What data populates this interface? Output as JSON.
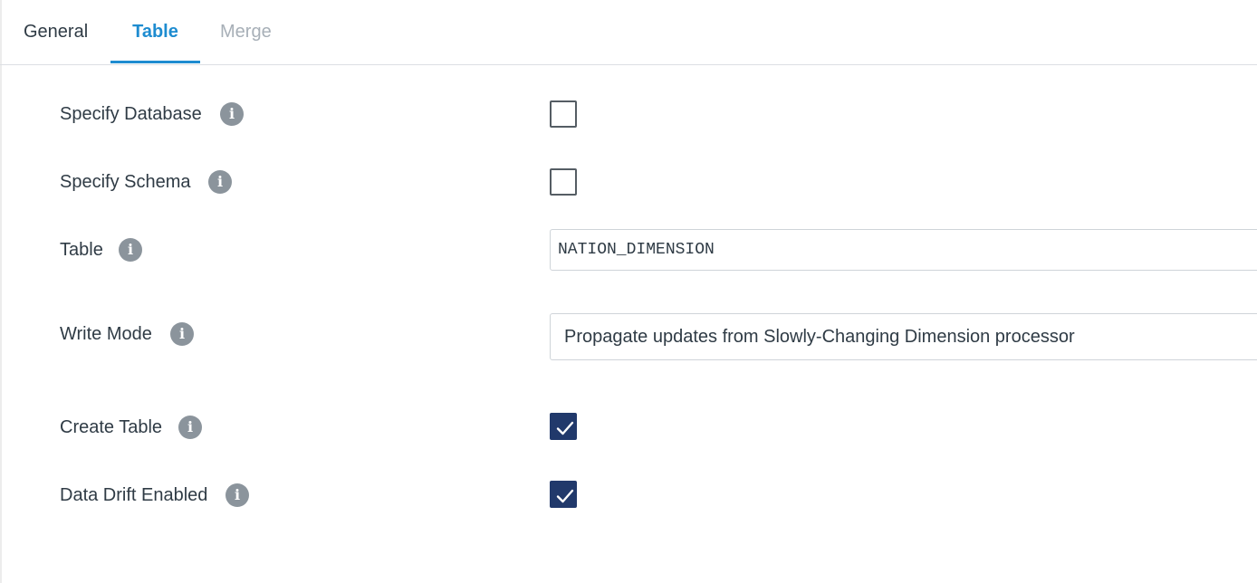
{
  "tabs": [
    {
      "label": "General",
      "state": "normal"
    },
    {
      "label": "Table",
      "state": "active"
    },
    {
      "label": "Merge",
      "state": "disabled"
    }
  ],
  "fields": {
    "specify_database": {
      "label": "Specify Database",
      "checked": false
    },
    "specify_schema": {
      "label": "Specify Schema",
      "checked": false
    },
    "table": {
      "label": "Table",
      "value": "NATION_DIMENSION"
    },
    "write_mode": {
      "label": "Write Mode",
      "value": "Propagate updates from Slowly-Changing Dimension processor"
    },
    "create_table": {
      "label": "Create Table",
      "checked": true
    },
    "data_drift_enabled": {
      "label": "Data Drift Enabled",
      "checked": true
    }
  },
  "icons": {
    "info": "info-icon",
    "check": "checkmark-icon"
  },
  "colors": {
    "accent": "#1e8cd0",
    "checkbox_checked": "#21396b",
    "info_icon": "#8b949c",
    "tab_disabled": "#a7afb7"
  }
}
